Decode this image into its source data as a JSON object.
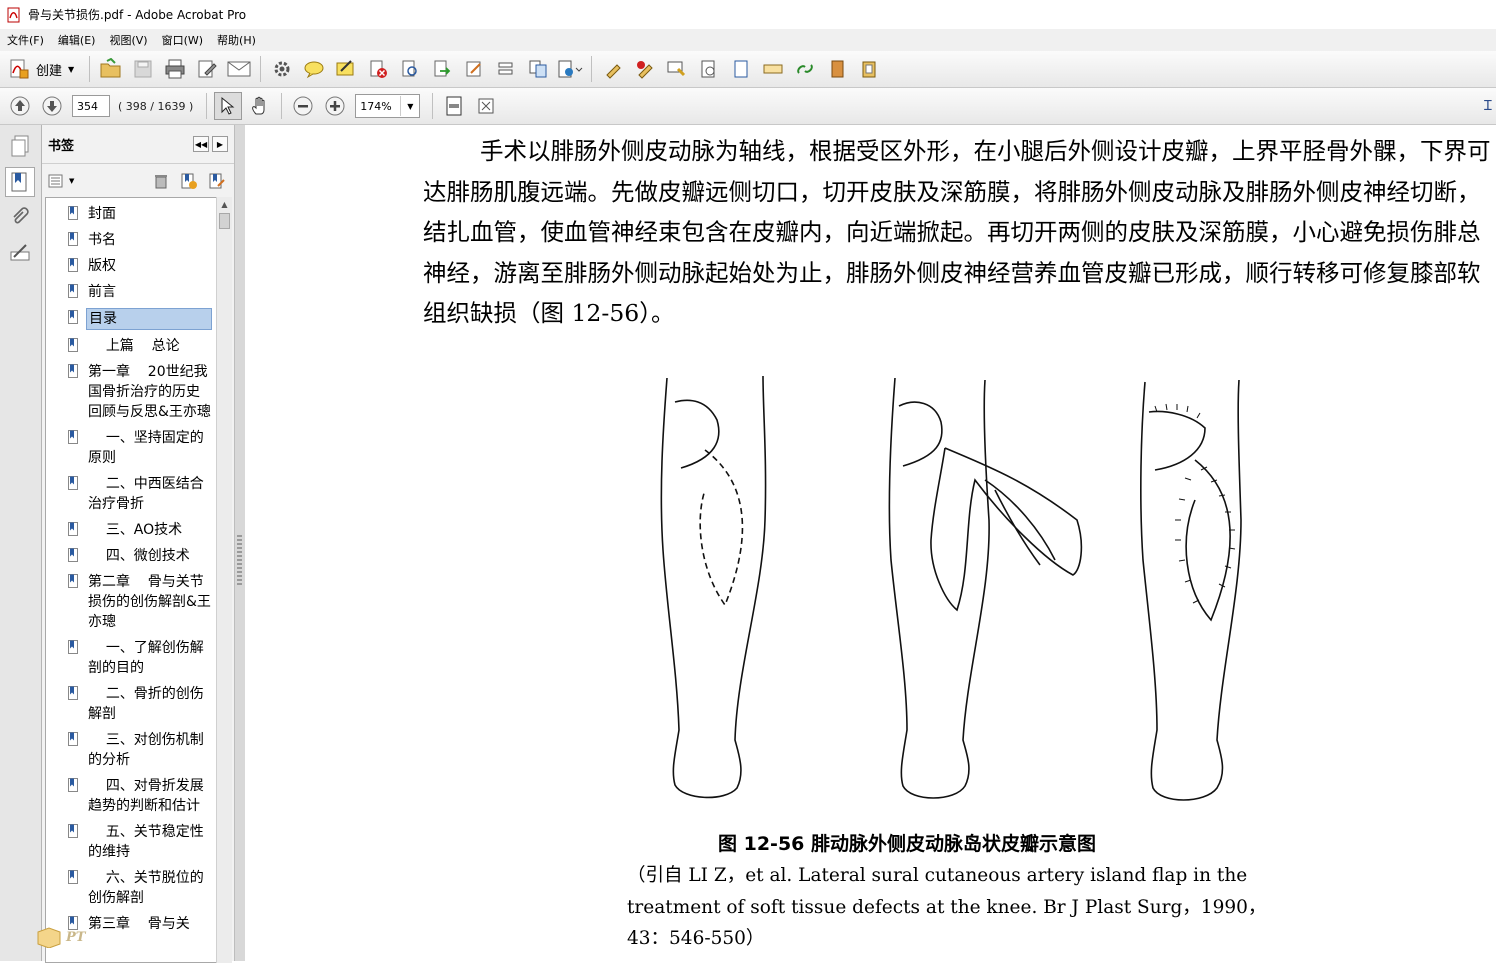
{
  "window": {
    "title": "骨与关节损伤.pdf - Adobe Acrobat Pro"
  },
  "menu": [
    "文件(F)",
    "编辑(E)",
    "视图(V)",
    "窗口(W)",
    "帮助(H)"
  ],
  "toolbar": {
    "create_label": "创建"
  },
  "navigation": {
    "page_number": "354",
    "page_count": "( 398 / 1639 )",
    "zoom": "174%"
  },
  "bookmarks": {
    "title": "书签",
    "items": [
      "封面",
      "书名",
      "版权",
      "前言",
      "目录",
      "    上篇    总论",
      "第一章    20世纪我国骨折治疗的历史回顾与反思&王亦璁",
      "    一、坚持固定的原则",
      "    二、中西医结合治疗骨折",
      "    三、AO技术",
      "    四、微创技术",
      "第二章    骨与关节损伤的创伤解剖&王亦璁",
      "    一、了解创伤解剖的目的",
      "    二、骨折的创伤解剖",
      "    三、对创伤机制的分析",
      "    四、对骨折发展趋势的判断和估计",
      "    五、关节稳定性的维持",
      "    六、关节脱位的创伤解剖",
      "第三章    骨与关"
    ],
    "selected_index": 4
  },
  "document": {
    "paragraph": "手术以腓肠外侧皮动脉为轴线，根据受区外形，在小腿后外侧设计皮瓣，上界平胫骨外髁，下界可达腓肠肌腹远端。先做皮瓣远侧切口，切开皮肤及深筋膜，将腓肠外侧皮动脉及腓肠外侧皮神经切断，结扎血管，使血管神经束包含在皮瓣内，向近端掀起。再切开两侧的皮肤及深筋膜，小心避免损伤腓总神经，游离至腓肠外侧动脉起始处为止，腓肠外侧皮神经营养血管皮瓣已形成，顺行转移可修复膝部软组织缺损（图 12-56）。",
    "figure_caption": "图 12-56    腓动脉外侧皮动脉岛状皮瓣示意图",
    "figure_source": "（引自 LI Z，et al.  Lateral sural cutaneous artery island flap in the treatment of soft tissue defects at the knee.  Br J Plast Surg，1990，43：546-550）"
  },
  "watermark": {
    "text": "PT"
  },
  "colors": {
    "selection": "#b8d0ec",
    "toolbar_bg": "#ececec"
  }
}
